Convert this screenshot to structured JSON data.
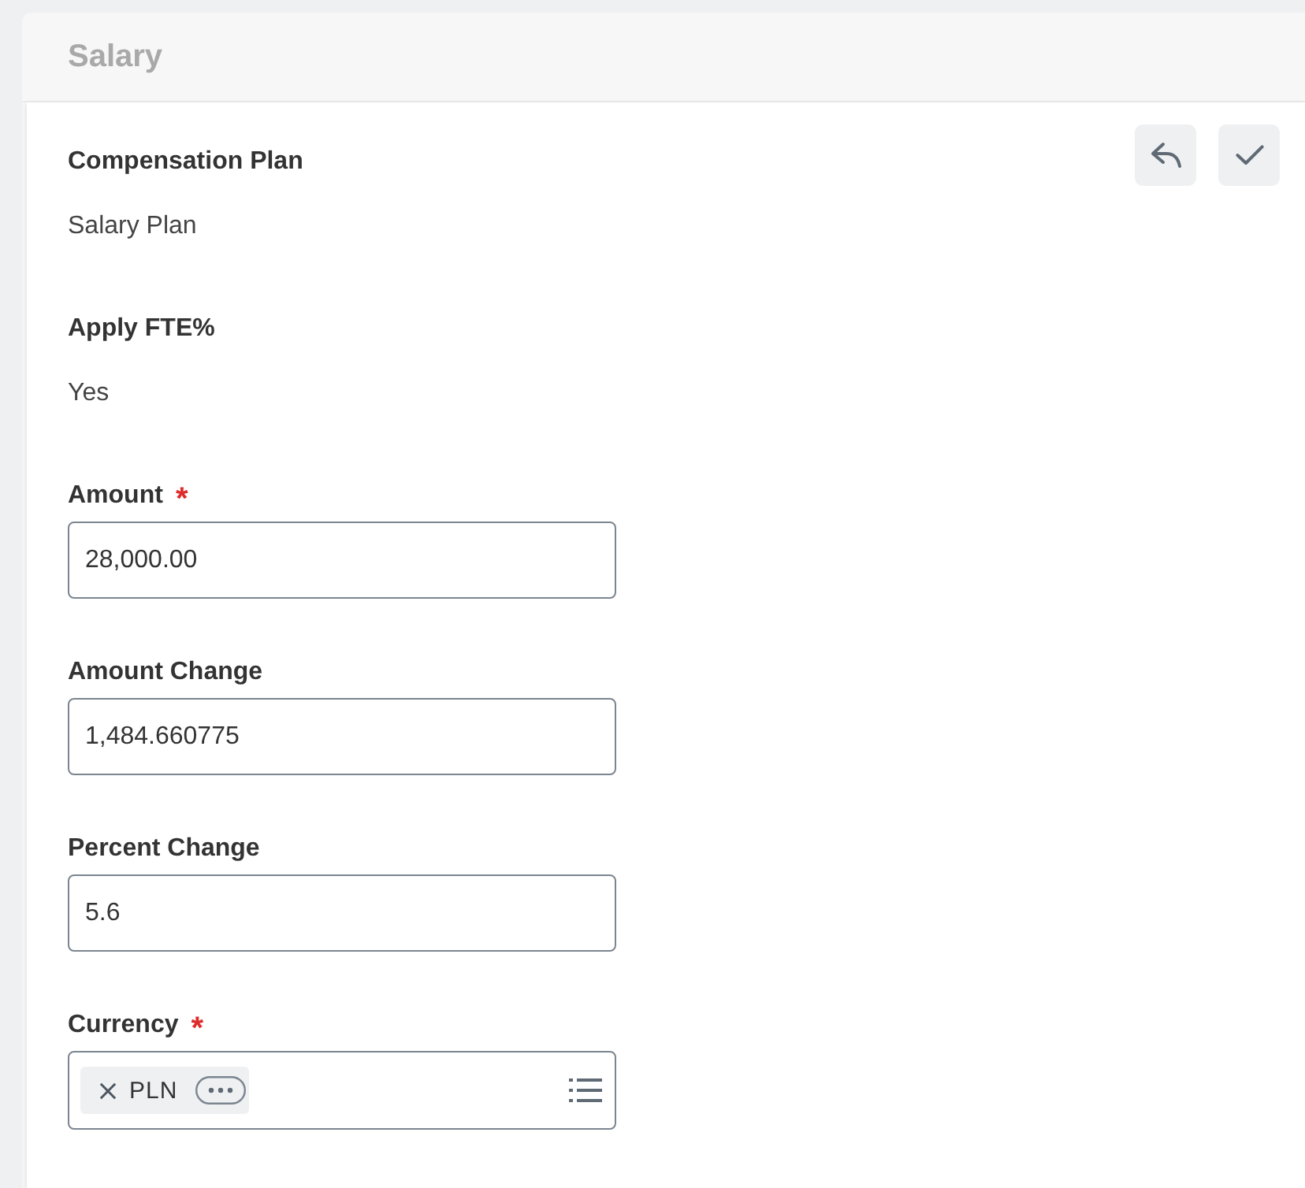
{
  "header": {
    "title": "Salary"
  },
  "toolbar": {
    "buttons": [
      {
        "kind": "undo"
      },
      {
        "kind": "confirm"
      }
    ]
  },
  "fields": [
    {
      "kind": "display",
      "label": "Compensation Plan",
      "value": "Salary Plan"
    },
    {
      "kind": "display",
      "label": "Apply FTE%",
      "value": "Yes"
    },
    {
      "kind": "input",
      "label": "Amount",
      "required_mark": "*",
      "value": "28,000.00"
    },
    {
      "kind": "input",
      "label": "Amount Change",
      "value": "1,484.660775"
    },
    {
      "kind": "input",
      "label": "Percent Change",
      "value": "5.6"
    },
    {
      "kind": "multiselect",
      "label": "Currency",
      "required_mark": "*",
      "chips": [
        {
          "label": "PLN"
        }
      ]
    }
  ]
}
